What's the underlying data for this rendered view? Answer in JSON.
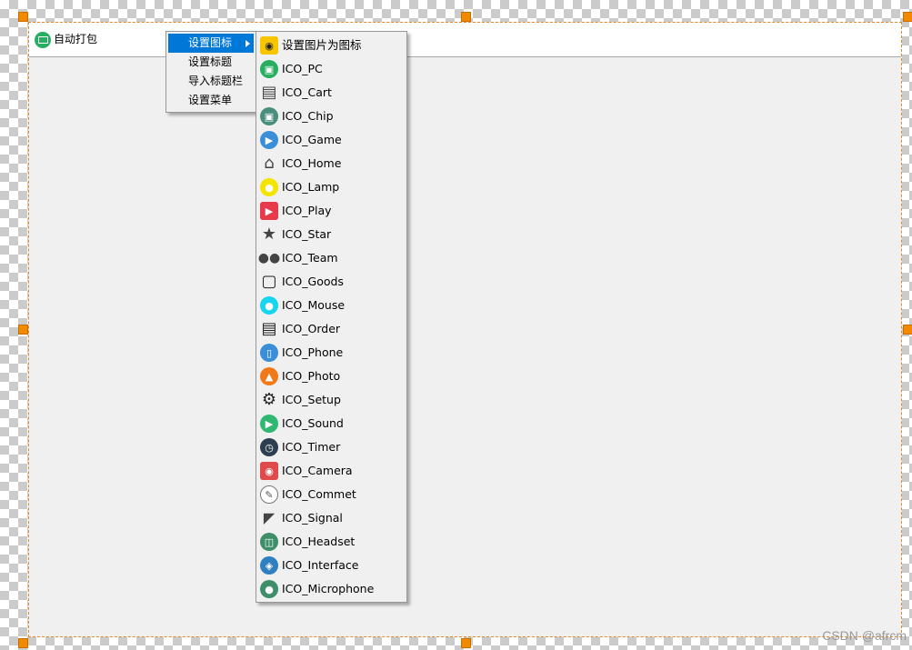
{
  "window": {
    "title": "自动打包",
    "icon": "pc-monitor-icon"
  },
  "context_menu": {
    "items": [
      {
        "label": "设置图标",
        "has_submenu": true,
        "active": true
      },
      {
        "label": "设置标题"
      },
      {
        "label": "导入标题栏"
      },
      {
        "label": "设置菜单"
      }
    ]
  },
  "submenu": {
    "items": [
      {
        "label": "设置图片为图标",
        "icon": "image-folder-icon",
        "color": "#f7c600"
      },
      {
        "label": "ICO_PC",
        "icon": "pc-icon",
        "color": "#27ae60"
      },
      {
        "label": "ICO_Cart",
        "icon": "cart-icon",
        "color": "#555555"
      },
      {
        "label": "ICO_Chip",
        "icon": "chip-icon",
        "color": "#4a8f7e"
      },
      {
        "label": "ICO_Game",
        "icon": "game-icon",
        "color": "#3a8fd8"
      },
      {
        "label": "ICO_Home",
        "icon": "home-icon",
        "color": "#555555"
      },
      {
        "label": "ICO_Lamp",
        "icon": "lamp-icon",
        "color": "#f4e400"
      },
      {
        "label": "ICO_Play",
        "icon": "play-icon",
        "color": "#e83a4a"
      },
      {
        "label": "ICO_Star",
        "icon": "star-icon",
        "color": "#444444"
      },
      {
        "label": "ICO_Team",
        "icon": "team-icon",
        "color": "#555555"
      },
      {
        "label": "ICO_Goods",
        "icon": "goods-icon",
        "color": "#333333"
      },
      {
        "label": "ICO_Mouse",
        "icon": "mouse-icon",
        "color": "#17d4f0"
      },
      {
        "label": "ICO_Order",
        "icon": "order-icon",
        "color": "#333333"
      },
      {
        "label": "ICO_Phone",
        "icon": "phone-icon",
        "color": "#3a8fd8"
      },
      {
        "label": "ICO_Photo",
        "icon": "photo-icon",
        "color": "#f07a1a"
      },
      {
        "label": "ICO_Setup",
        "icon": "setup-icon",
        "color": "#222222"
      },
      {
        "label": "ICO_Sound",
        "icon": "sound-icon",
        "color": "#2eb872"
      },
      {
        "label": "ICO_Timer",
        "icon": "timer-icon",
        "color": "#2c3e50"
      },
      {
        "label": "ICO_Camera",
        "icon": "camera-icon",
        "color": "#e04a4a"
      },
      {
        "label": "ICO_Commet",
        "icon": "comment-icon",
        "color": "#666666"
      },
      {
        "label": "ICO_Signal",
        "icon": "signal-icon",
        "color": "#444444"
      },
      {
        "label": "ICO_Headset",
        "icon": "headset-icon",
        "color": "#3e8e6a"
      },
      {
        "label": "ICO_Interface",
        "icon": "interface-icon",
        "color": "#2f7fc1"
      },
      {
        "label": "ICO_Microphone",
        "icon": "microphone-icon",
        "color": "#3e8e6a"
      }
    ]
  },
  "watermark": "CSDN @afrcm",
  "accent_color": "#0078d7",
  "handle_color": "#f28a00"
}
